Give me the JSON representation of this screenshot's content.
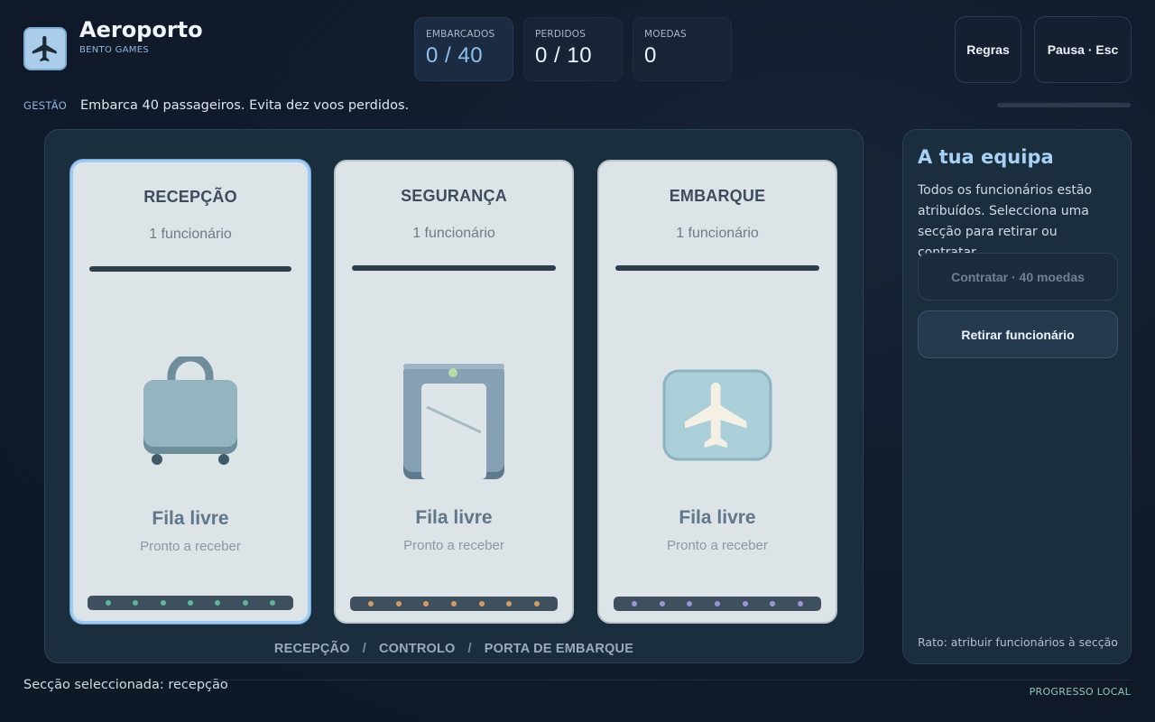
{
  "header": {
    "title": "Aeroporto",
    "subtitle": "BENTO GAMES",
    "app_icon": "airplane-icon"
  },
  "stats": [
    {
      "label": "EMBARCADOS",
      "value": "0 / 40"
    },
    {
      "label": "PERDIDOS",
      "value": "0 / 10"
    },
    {
      "label": "MOEDAS",
      "value": "0"
    }
  ],
  "buttons": {
    "rules": "Regras",
    "pause": "Pausa · Esc"
  },
  "objective": {
    "mode": "GESTÃO",
    "text": "Embarca 40 passageiros. Evita dez voos perdidos.",
    "progress": 0
  },
  "sections": [
    {
      "title": "RECEPÇÃO",
      "staff": "1 funcionário",
      "status": "Fila livre",
      "sub": "Pronto a receber",
      "icon": "suitcase-icon",
      "dot_color": "#5fb79a",
      "dots": 7
    },
    {
      "title": "SEGURANÇA",
      "staff": "1 funcionário",
      "status": "Fila livre",
      "sub": "Pronto a receber",
      "icon": "security-scanner-icon",
      "dot_color": "#d59a62",
      "dots": 7
    },
    {
      "title": "EMBARQUE",
      "staff": "1 funcionário",
      "status": "Fila livre",
      "sub": "Pronto a receber",
      "icon": "airplane-icon",
      "dot_color": "#9b93d8",
      "dots": 7
    }
  ],
  "board_footer": {
    "a": "RECEPÇÃO",
    "b": "CONTROLO",
    "c": "PORTA DE EMBARQUE",
    "sep": "/"
  },
  "panel": {
    "title": "A tua equipa",
    "text": "Todos os funcionários estão atribuídos. Selecciona uma secção para retirar ou contratar.",
    "hire": "Contratar · 40 moedas",
    "remove": "Retirar funcionário",
    "hint": "Rato: atribuir funcionários à secção"
  },
  "footer": {
    "status": "Secção seleccionada: recepção",
    "local": "PROGRESSO LOCAL"
  }
}
